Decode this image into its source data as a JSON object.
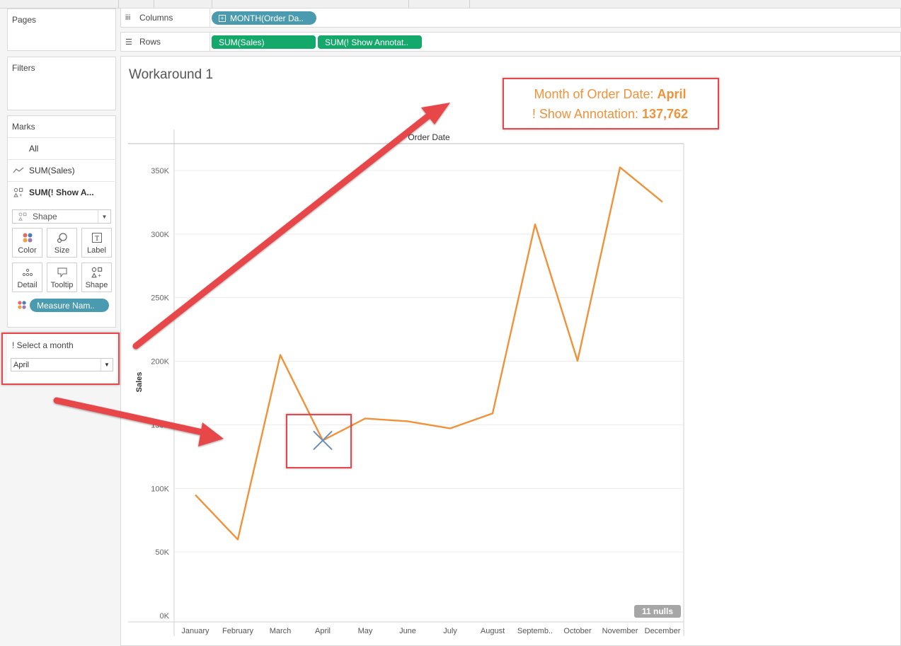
{
  "left_panel": {
    "pages": {
      "title": "Pages"
    },
    "filters": {
      "title": "Filters"
    },
    "marks": {
      "title": "Marks",
      "items": [
        {
          "label": "All",
          "icon": "none"
        },
        {
          "label": "SUM(Sales)",
          "icon": "line-icon"
        },
        {
          "label": "SUM(! Show A...",
          "icon": "shapes-icon"
        }
      ],
      "mark_type": "Shape",
      "buttons": [
        {
          "label": "Color",
          "icon": "color-dots-icon"
        },
        {
          "label": "Size",
          "icon": "size-icon"
        },
        {
          "label": "Label",
          "icon": "label-icon"
        },
        {
          "label": "Detail",
          "icon": "detail-dots-icon"
        },
        {
          "label": "Tooltip",
          "icon": "tooltip-icon"
        },
        {
          "label": "Shape",
          "icon": "shapes-icon"
        }
      ],
      "color_pill": "Measure Nam.."
    },
    "parameter": {
      "title": "! Select a month",
      "value": "April"
    }
  },
  "shelves": {
    "columns_label": "Columns",
    "columns_pill": "MONTH(Order Da..",
    "rows_label": "Rows",
    "rows_pills": [
      "SUM(Sales)",
      "SUM(! Show Annotat.."
    ]
  },
  "sheet": {
    "title": "Workaround 1",
    "annotation": {
      "line1_label": "Month of Order Date:",
      "line1_value": "April",
      "line2_label": "! Show Annotation:",
      "line2_value": "137,762"
    },
    "nulls_badge": "11 nulls"
  },
  "chart_data": {
    "type": "line",
    "header": "Order Date",
    "ylabel": "Sales",
    "categories": [
      "January",
      "February",
      "March",
      "April",
      "May",
      "June",
      "July",
      "August",
      "Septemb..",
      "October",
      "November",
      "December"
    ],
    "series": [
      {
        "values": [
          94900,
          59800,
          205000,
          137762,
          155000,
          152800,
          147200,
          159000,
          307700,
          200300,
          352500,
          325300
        ],
        "color": "#f0923a"
      }
    ],
    "annotation_point": {
      "category": "April",
      "value": 137762,
      "marker": "x",
      "color": "#6b8fb5"
    },
    "yticks": [
      0,
      50000,
      100000,
      150000,
      200000,
      250000,
      300000,
      350000
    ],
    "ytick_labels": [
      "0K",
      "50K",
      "100K",
      "150K",
      "200K",
      "250K",
      "300K",
      "350K"
    ],
    "ylim": [
      0,
      370000
    ],
    "grid": true
  },
  "colors": {
    "line": "#f0923a",
    "annotation": "#f0923a",
    "highlight": "#e8464a",
    "pill_teal": "#4a9bb0",
    "pill_green": "#14a86b"
  }
}
